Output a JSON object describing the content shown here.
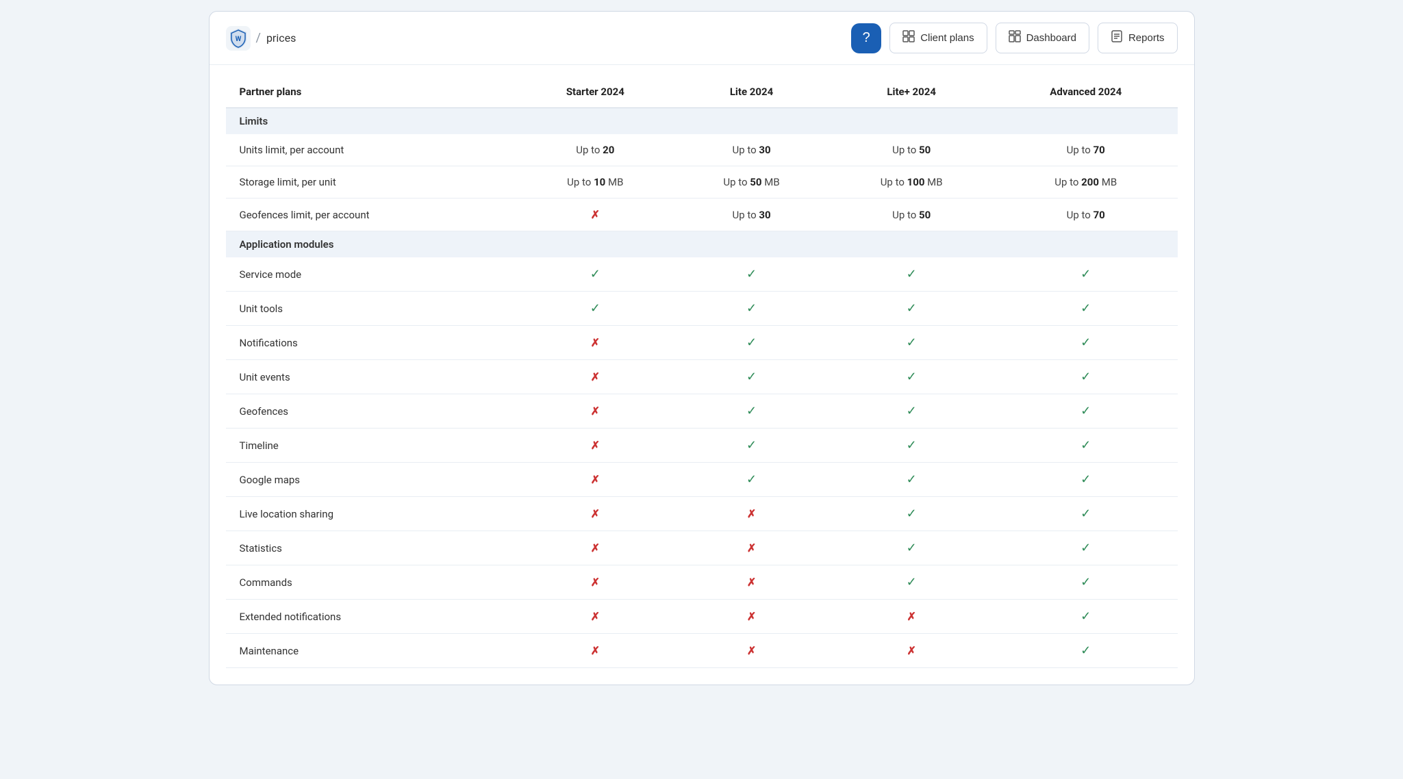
{
  "header": {
    "brand_icon_alt": "brand-shield",
    "breadcrumb_separator": "/",
    "breadcrumb_label": "prices",
    "help_button_icon": "?",
    "nav_buttons": [
      {
        "id": "client-plans",
        "label": "Client plans",
        "icon": "grid"
      },
      {
        "id": "dashboard",
        "label": "Dashboard",
        "icon": "dashboard"
      },
      {
        "id": "reports",
        "label": "Reports",
        "icon": "reports"
      }
    ]
  },
  "table": {
    "columns": [
      {
        "id": "feature",
        "label": "Partner plans"
      },
      {
        "id": "starter",
        "label": "Starter 2024"
      },
      {
        "id": "lite",
        "label": "Lite 2024"
      },
      {
        "id": "lite_plus",
        "label": "Lite+ 2024"
      },
      {
        "id": "advanced",
        "label": "Advanced 2024"
      }
    ],
    "sections": [
      {
        "id": "limits",
        "label": "Limits",
        "rows": [
          {
            "feature": "Units limit, per account",
            "starter": {
              "type": "text",
              "value": "Up to ",
              "bold": "20"
            },
            "lite": {
              "type": "text",
              "value": "Up to ",
              "bold": "30"
            },
            "lite_plus": {
              "type": "text",
              "value": "Up to ",
              "bold": "50"
            },
            "advanced": {
              "type": "text",
              "value": "Up to ",
              "bold": "70"
            }
          },
          {
            "feature": "Storage limit, per unit",
            "starter": {
              "type": "text",
              "value": "Up to ",
              "bold": "10",
              "suffix": " MB"
            },
            "lite": {
              "type": "text",
              "value": "Up to ",
              "bold": "50",
              "suffix": " MB"
            },
            "lite_plus": {
              "type": "text",
              "value": "Up to ",
              "bold": "100",
              "suffix": " MB"
            },
            "advanced": {
              "type": "text",
              "value": "Up to ",
              "bold": "200",
              "suffix": " MB"
            }
          },
          {
            "feature": "Geofences limit, per account",
            "starter": {
              "type": "cross"
            },
            "lite": {
              "type": "text",
              "value": "Up to ",
              "bold": "30"
            },
            "lite_plus": {
              "type": "text",
              "value": "Up to ",
              "bold": "50"
            },
            "advanced": {
              "type": "text",
              "value": "Up to ",
              "bold": "70"
            }
          }
        ]
      },
      {
        "id": "app_modules",
        "label": "Application modules",
        "rows": [
          {
            "feature": "Service mode",
            "starter": {
              "type": "check"
            },
            "lite": {
              "type": "check"
            },
            "lite_plus": {
              "type": "check"
            },
            "advanced": {
              "type": "check"
            }
          },
          {
            "feature": "Unit tools",
            "starter": {
              "type": "check"
            },
            "lite": {
              "type": "check"
            },
            "lite_plus": {
              "type": "check"
            },
            "advanced": {
              "type": "check"
            }
          },
          {
            "feature": "Notifications",
            "starter": {
              "type": "cross"
            },
            "lite": {
              "type": "check"
            },
            "lite_plus": {
              "type": "check"
            },
            "advanced": {
              "type": "check"
            }
          },
          {
            "feature": "Unit events",
            "starter": {
              "type": "cross"
            },
            "lite": {
              "type": "check"
            },
            "lite_plus": {
              "type": "check"
            },
            "advanced": {
              "type": "check"
            }
          },
          {
            "feature": "Geofences",
            "starter": {
              "type": "cross"
            },
            "lite": {
              "type": "check"
            },
            "lite_plus": {
              "type": "check"
            },
            "advanced": {
              "type": "check"
            }
          },
          {
            "feature": "Timeline",
            "starter": {
              "type": "cross"
            },
            "lite": {
              "type": "check"
            },
            "lite_plus": {
              "type": "check"
            },
            "advanced": {
              "type": "check"
            }
          },
          {
            "feature": "Google maps",
            "starter": {
              "type": "cross"
            },
            "lite": {
              "type": "check"
            },
            "lite_plus": {
              "type": "check"
            },
            "advanced": {
              "type": "check"
            }
          },
          {
            "feature": "Live location sharing",
            "starter": {
              "type": "cross"
            },
            "lite": {
              "type": "cross"
            },
            "lite_plus": {
              "type": "check"
            },
            "advanced": {
              "type": "check"
            }
          },
          {
            "feature": "Statistics",
            "starter": {
              "type": "cross"
            },
            "lite": {
              "type": "cross"
            },
            "lite_plus": {
              "type": "check"
            },
            "advanced": {
              "type": "check"
            }
          },
          {
            "feature": "Commands",
            "starter": {
              "type": "cross"
            },
            "lite": {
              "type": "cross"
            },
            "lite_plus": {
              "type": "check"
            },
            "advanced": {
              "type": "check"
            }
          },
          {
            "feature": "Extended notifications",
            "starter": {
              "type": "cross"
            },
            "lite": {
              "type": "cross"
            },
            "lite_plus": {
              "type": "cross"
            },
            "advanced": {
              "type": "check"
            }
          },
          {
            "feature": "Maintenance",
            "starter": {
              "type": "cross"
            },
            "lite": {
              "type": "cross"
            },
            "lite_plus": {
              "type": "cross"
            },
            "advanced": {
              "type": "check"
            }
          }
        ]
      }
    ]
  }
}
